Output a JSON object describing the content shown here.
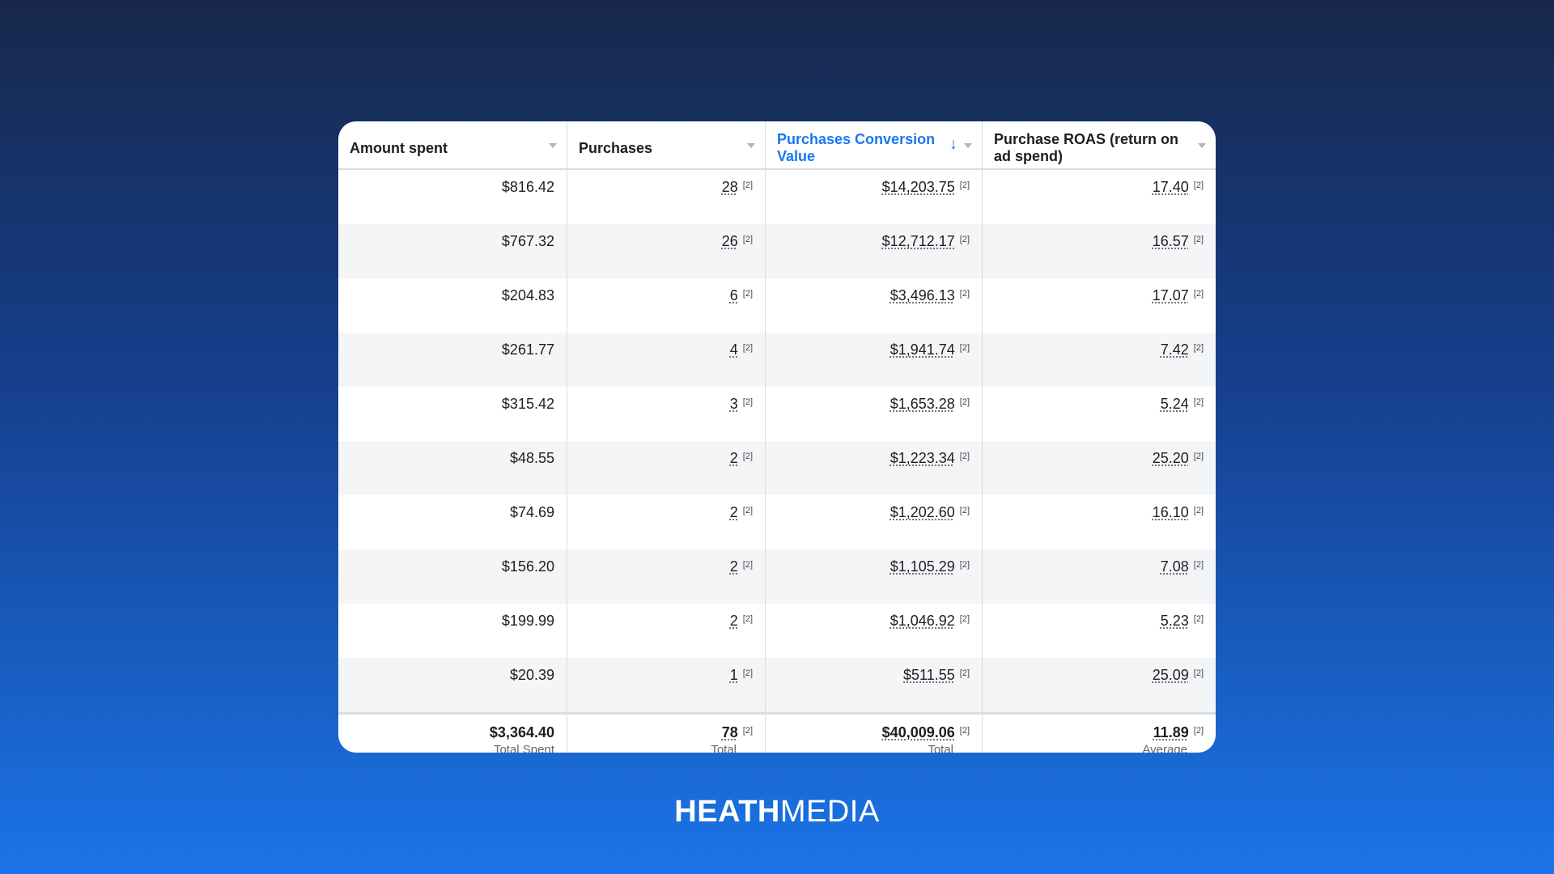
{
  "columns": [
    {
      "label": "Amount spent",
      "active": false
    },
    {
      "label": "Purchases",
      "active": false
    },
    {
      "label": "Purchases Conversion Value",
      "active": true
    },
    {
      "label": "Purchase ROAS (return on ad spend)",
      "active": false
    }
  ],
  "footnote": "[2]",
  "rows": [
    [
      "$816.42",
      "28",
      "$14,203.75",
      "17.40"
    ],
    [
      "$767.32",
      "26",
      "$12,712.17",
      "16.57"
    ],
    [
      "$204.83",
      "6",
      "$3,496.13",
      "17.07"
    ],
    [
      "$261.77",
      "4",
      "$1,941.74",
      "7.42"
    ],
    [
      "$315.42",
      "3",
      "$1,653.28",
      "5.24"
    ],
    [
      "$48.55",
      "2",
      "$1,223.34",
      "25.20"
    ],
    [
      "$74.69",
      "2",
      "$1,202.60",
      "16.10"
    ],
    [
      "$156.20",
      "2",
      "$1,105.29",
      "7.08"
    ],
    [
      "$199.99",
      "2",
      "$1,046.92",
      "5.23"
    ],
    [
      "$20.39",
      "1",
      "$511.55",
      "25.09"
    ]
  ],
  "totals": [
    {
      "value": "$3,364.40",
      "label": "Total Spent"
    },
    {
      "value": "78",
      "label": "Total"
    },
    {
      "value": "$40,009.06",
      "label": "Total"
    },
    {
      "value": "11.89",
      "label": "Average"
    }
  ],
  "brand": {
    "bold": "HEATH",
    "light": "MEDIA"
  },
  "colors": {
    "accent": "#1877f2",
    "alt_row": "#f4f5f7"
  }
}
